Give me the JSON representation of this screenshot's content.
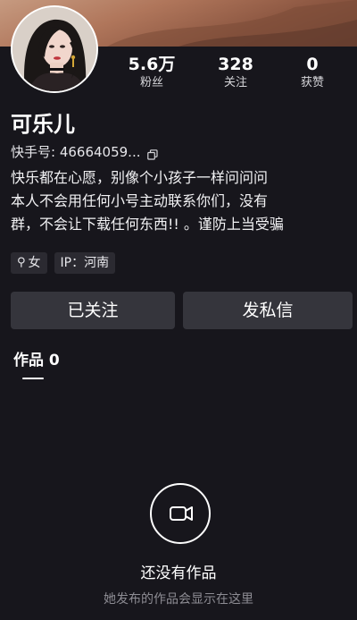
{
  "profile": {
    "name": "可乐儿",
    "uid": "快手号: 46664059...",
    "bio": [
      "快乐都在心愿，别像个小孩子一样问问问",
      "本人不会用任何小号主动联系你们，没有",
      "群，不会让下载任何东西!! 。谨防上当受骗"
    ],
    "tags": {
      "gender": "女",
      "ip": "IP：河南"
    }
  },
  "stats": [
    {
      "value": "5.6万",
      "label": "粉丝"
    },
    {
      "value": "328",
      "label": "关注"
    },
    {
      "value": "0",
      "label": "获赞"
    }
  ],
  "actions": {
    "follow_label": "已关注",
    "message_label": "发私信"
  },
  "tabs": {
    "works_label": "作品 0"
  },
  "empty_state": {
    "title": "还没有作品",
    "subtitle": "她发布的作品会显示在这里"
  },
  "icons": {
    "copy": "copy-icon",
    "gender": "female-icon",
    "empty": "video-camera-icon"
  },
  "colors": {
    "background": "#17161c",
    "button": "#35353c",
    "tag": "#2b2a31",
    "muted_text": "#8d8c93"
  }
}
